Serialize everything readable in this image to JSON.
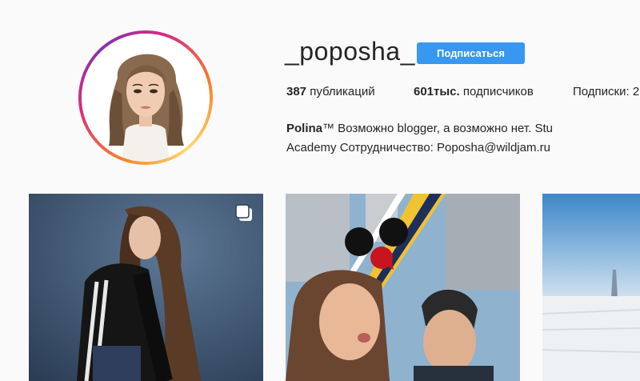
{
  "profile": {
    "username": "_poposha_",
    "follow_label": "Подписаться",
    "stats": {
      "posts_count": "387",
      "posts_label": "публикаций",
      "followers_count": "601тыс.",
      "followers_label": "подписчиков",
      "following_label": "Подписки: 2"
    },
    "bio": {
      "name": "Polina",
      "line1_rest": "™ Возможно blogger, а возможно нет. Stu",
      "line2": "Academy Сотрудничество: Poposha@wildjam.ru"
    }
  },
  "posts": [
    {
      "icon": "multiple-images-icon"
    },
    {},
    {}
  ],
  "colors": {
    "follow_button": "#3897f0",
    "background": "#fafafa",
    "ring_gradient": [
      "#f58529",
      "#dd2a7b",
      "#8134af"
    ]
  }
}
